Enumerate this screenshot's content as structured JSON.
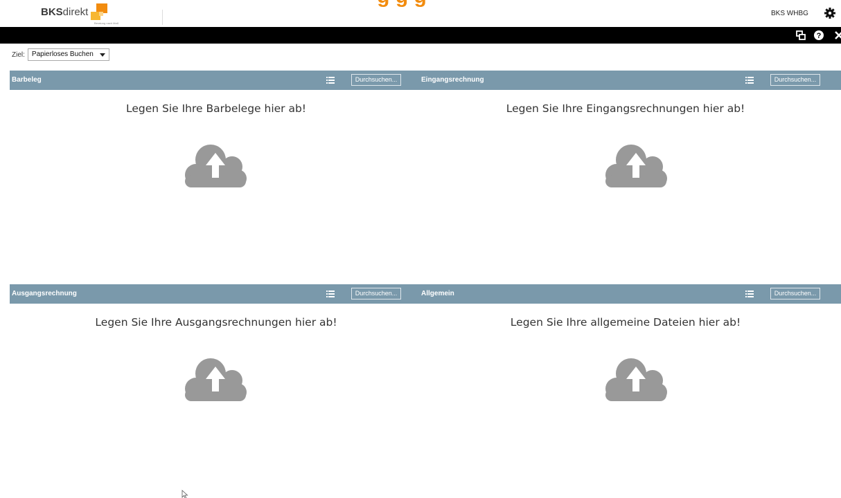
{
  "header": {
    "logo_bold": "BKS",
    "logo_rest": "direkt",
    "logo_tagline": "Beratung nach Maß",
    "page_heading": "g  g  g",
    "user": "BKS WHBG"
  },
  "toolbar": {
    "icons": [
      "window-restore-icon",
      "help-icon",
      "close-icon"
    ]
  },
  "target": {
    "label": "Ziel:",
    "selected": "Papierloses Buchen"
  },
  "panels": [
    {
      "title": "Barbeleg",
      "browse_label": "Durchsuchen...",
      "drop_message": "Legen Sie Ihre Barbelege hier ab!"
    },
    {
      "title": "Eingangsrechnung",
      "browse_label": "Durchsuchen...",
      "drop_message": "Legen Sie Ihre Eingangsrechnungen hier ab!"
    },
    {
      "title": "Ausgangsrechnung",
      "browse_label": "Durchsuchen...",
      "drop_message": "Legen Sie Ihre Ausgangsrechnungen hier ab!"
    },
    {
      "title": "Allgemein",
      "browse_label": "Durchsuchen...",
      "drop_message": "Legen Sie Ihre allgemeine Dateien hier ab!"
    }
  ],
  "colors": {
    "accent": "#f28c0f",
    "panel_header": "#7a99ab",
    "cloud": "#999999",
    "toolbar": "#000000"
  }
}
